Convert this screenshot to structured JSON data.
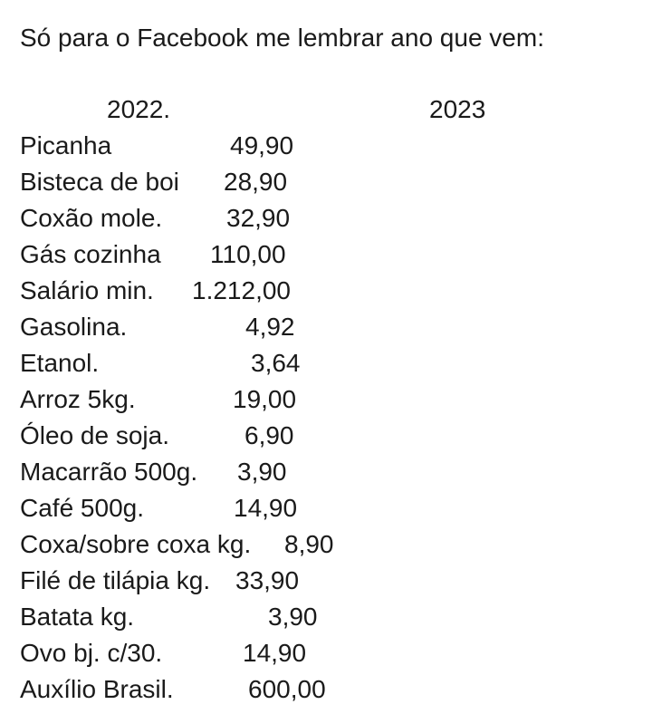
{
  "title": "Só para o Facebook me lembrar ano que vem:",
  "years": {
    "first": "2022.",
    "second": "2023"
  },
  "items": [
    {
      "name": "Picanha",
      "price": "49,90"
    },
    {
      "name": "Bisteca de boi",
      "price": "28,90"
    },
    {
      "name": "Coxão mole.",
      "price": "32,90"
    },
    {
      "name": "Gás cozinha",
      "price": "110,00"
    },
    {
      "name": "Salário min.",
      "price": "1.212,00"
    },
    {
      "name": "Gasolina.",
      "price": "4,92"
    },
    {
      "name": "Etanol.",
      "price": "3,64"
    },
    {
      "name": "Arroz 5kg.",
      "price": "19,00"
    },
    {
      "name": "Óleo de soja.",
      "price": "6,90"
    },
    {
      "name": "Macarrão 500g.",
      "price": "3,90"
    },
    {
      "name": "Café 500g.",
      "price": "14,90"
    },
    {
      "name": "Coxa/sobre coxa kg.",
      "price": "8,90"
    },
    {
      "name": "Filé de tilápia kg.",
      "price": "33,90"
    },
    {
      "name": "Batata kg.",
      "price": "3,90"
    },
    {
      "name": "Ovo bj. c/30.",
      "price": "14,90"
    },
    {
      "name": "Auxílio Brasil.",
      "price": "600,00"
    }
  ]
}
